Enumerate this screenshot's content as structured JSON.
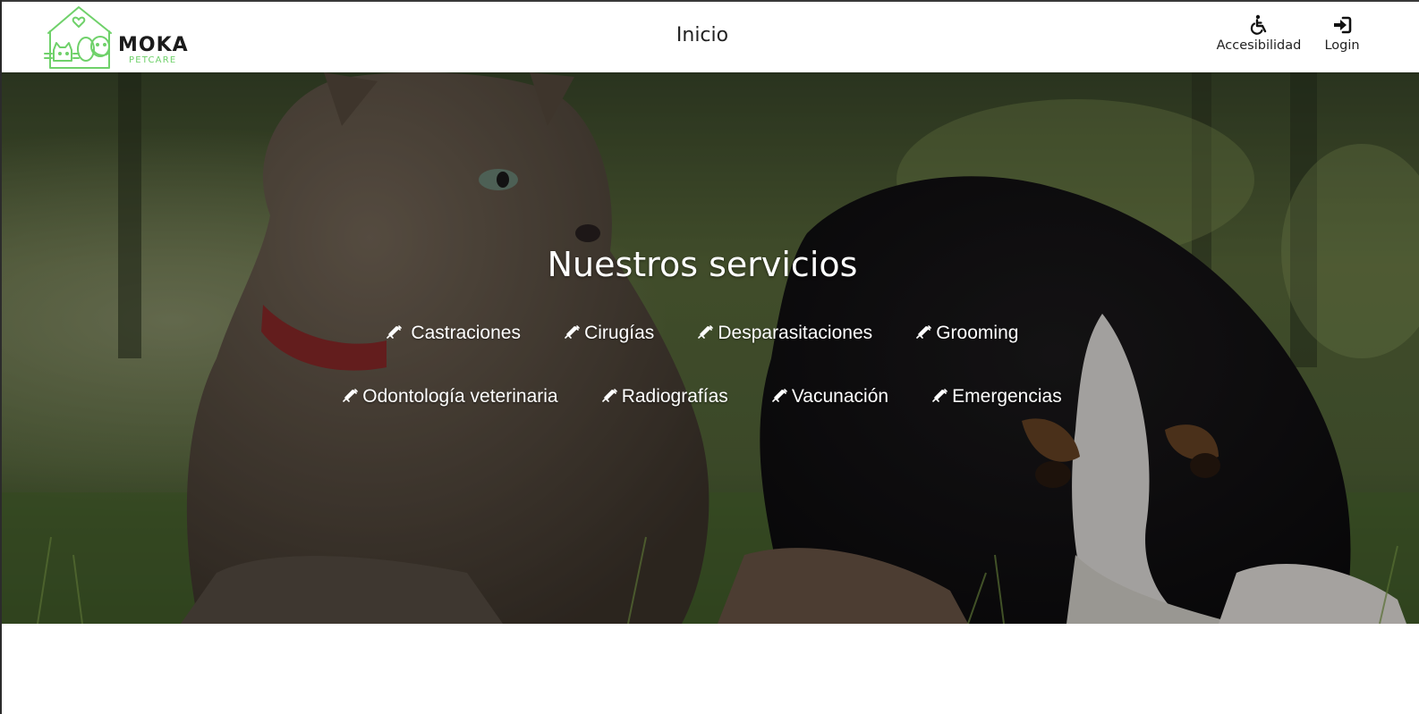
{
  "brand": {
    "name": "MOKA",
    "tagline": "PETCARE",
    "accent_color": "#6fd16a"
  },
  "nav": {
    "home_label": "Inicio"
  },
  "header_actions": {
    "accessibility": {
      "label": "Accesibilidad",
      "icon": "wheelchair-icon"
    },
    "login": {
      "label": "Login",
      "icon": "sign-in-icon"
    }
  },
  "hero": {
    "title": "Nuestros servicios",
    "service_icon": "syringe-icon",
    "services": [
      {
        "label": "Castraciones"
      },
      {
        "label": "Cirugías"
      },
      {
        "label": "Desparasitaciones"
      },
      {
        "label": "Grooming"
      },
      {
        "label": "Odontología veterinaria"
      },
      {
        "label": "Radiografías"
      },
      {
        "label": "Vacunación"
      },
      {
        "label": "Emergencias"
      }
    ]
  }
}
